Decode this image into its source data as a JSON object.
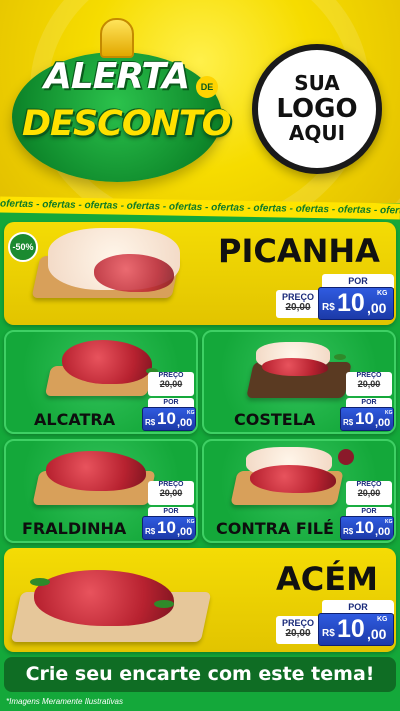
{
  "header": {
    "title_line1": "ALERTA",
    "title_de": "DE",
    "title_line2": "DESCONTO",
    "logo_line1": "SUA",
    "logo_line2": "LOGO",
    "logo_line3": "AQUI"
  },
  "tape_text": "ofertas - ofertas - ofertas - ofertas - ofertas - ofertas - ofertas - ofertas - ofertas - ofertas",
  "discount_badge": "-50%",
  "currency": "R$",
  "old_label": "PREÇO",
  "new_label": "POR",
  "unit": "KG",
  "products": {
    "picanha": {
      "name": "PICANHA",
      "old_price": "20,00",
      "price_int": "10",
      "price_dec": ",00"
    },
    "alcatra": {
      "name": "ALCATRA",
      "old_price": "20,00",
      "price_int": "10",
      "price_dec": ",00"
    },
    "costela": {
      "name": "COSTELA",
      "old_price": "20,00",
      "price_int": "10",
      "price_dec": ",00"
    },
    "fraldinha": {
      "name": "FRALDINHA",
      "old_price": "20,00",
      "price_int": "10",
      "price_dec": ",00"
    },
    "contra_file": {
      "name": "CONTRA FILÉ",
      "old_price": "20,00",
      "price_int": "10",
      "price_dec": ",00"
    },
    "acem": {
      "name": "ACÉM",
      "old_price": "20,00",
      "price_int": "10",
      "price_dec": ",00"
    }
  },
  "cta": "Crie seu encarte com este tema!",
  "footnote": "*Imagens Meramente Ilustrativas",
  "colors": {
    "green": "#14a83a",
    "yellow": "#f4dc05",
    "blue": "#1c3aa8"
  }
}
